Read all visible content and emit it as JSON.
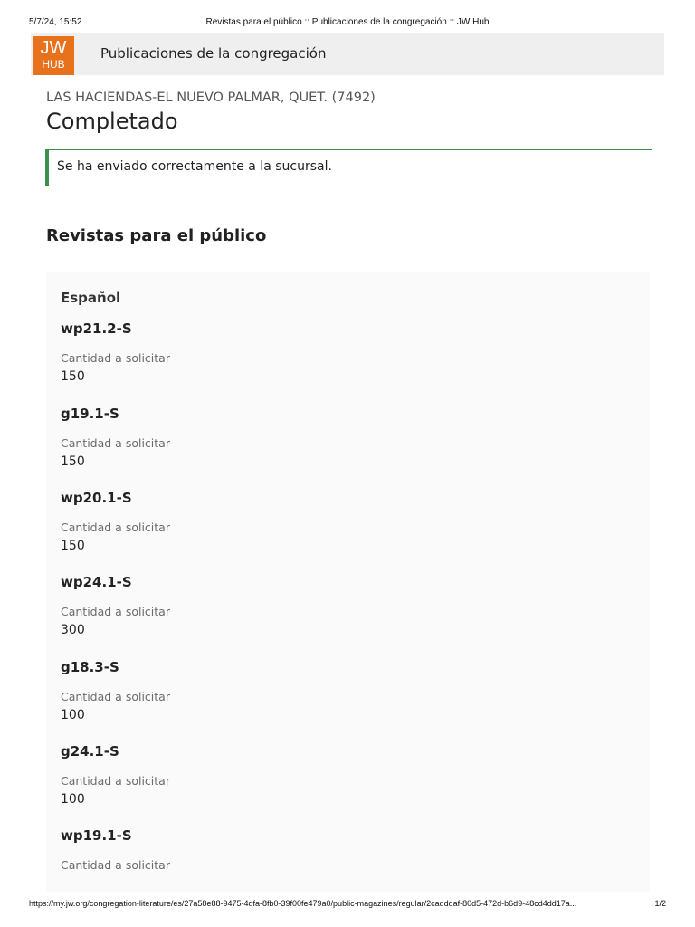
{
  "print_header": {
    "date": "5/7/24, 15:52",
    "title": "Revistas para el público :: Publicaciones de la congregación :: JW Hub"
  },
  "app_bar": {
    "logo_top": "JW",
    "logo_bottom": "HUB",
    "title": "Publicaciones de la congregación"
  },
  "congregation": "LAS HACIENDAS-EL NUEVO PALMAR, QUET. (7492)",
  "page_title": "Completado",
  "alert": {
    "text": "Se ha enviado correctamente a la sucursal.",
    "color": "#3c8f4c"
  },
  "section_title": "Revistas para el público",
  "language": "Español",
  "items": [
    {
      "code": "wp21.2-S",
      "label": "Cantidad a solicitar",
      "quantity": "150"
    },
    {
      "code": "g19.1-S",
      "label": "Cantidad a solicitar",
      "quantity": "150"
    },
    {
      "code": "wp20.1-S",
      "label": "Cantidad a solicitar",
      "quantity": "150"
    },
    {
      "code": "wp24.1-S",
      "label": "Cantidad a solicitar",
      "quantity": "300"
    },
    {
      "code": "g18.3-S",
      "label": "Cantidad a solicitar",
      "quantity": "100"
    },
    {
      "code": "g24.1-S",
      "label": "Cantidad a solicitar",
      "quantity": "100"
    },
    {
      "code": "wp19.1-S",
      "label": "Cantidad a solicitar",
      "quantity": ""
    }
  ],
  "print_footer": {
    "url": "https://my.jw.org/congregation-literature/es/27a58e88-9475-4dfa-8fb0-39f00fe479a0/public-magazines/regular/2cadddaf-80d5-472d-b6d9-48cd4dd17a...",
    "page": "1/2"
  },
  "colors": {
    "brand": "#e8711c",
    "app_bar_bg": "#efefef",
    "panel_bg": "#fafafa"
  }
}
